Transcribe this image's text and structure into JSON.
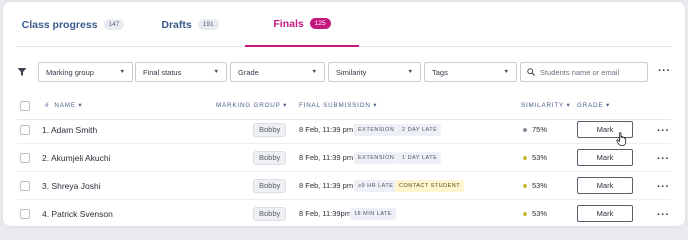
{
  "tabs": [
    {
      "label": "Class progress",
      "count": "147"
    },
    {
      "label": "Drafts",
      "count": "191"
    },
    {
      "label": "Finals",
      "count": "125"
    }
  ],
  "filters": {
    "marking_group": "Marking group",
    "final_status": "Final status",
    "grade": "Grade",
    "similarity": "Similarity",
    "tags": "Tags",
    "search_placeholder": "Students name or email"
  },
  "columns": {
    "number": "#",
    "name": "NAME",
    "marking_group": "MARKING GROUP",
    "final_submission": "FINAL SUBMISSION",
    "similarity": "SIMILARITY",
    "grade": "GRADE",
    "sort_glyph": "▾"
  },
  "rows": [
    {
      "name": "1. Adam Smith",
      "group": "Bobby",
      "date": "8 Feb, 11:39 pm",
      "badges": [
        "EXTENSION",
        "2 DAY LATE"
      ],
      "similarity": "75%",
      "sim_color": "#8e8896",
      "action": "Mark"
    },
    {
      "name": "2. Akumjeli Akuchi",
      "group": "Bobby",
      "date": "8 Feb, 11:39 pm",
      "badges": [
        "EXTENSION",
        "1 DAY LATE"
      ],
      "similarity": "53%",
      "sim_color": "#c9b93a",
      "action": "Mark"
    },
    {
      "name": "3. Shreya Joshi",
      "group": "Bobby",
      "date": "8 Feb, 11:39 pm",
      "badges": [
        "≥9 HR LATE",
        "CONTACT STUDENT"
      ],
      "similarity": "53%",
      "sim_color": "#c9b93a",
      "action": "Mark"
    },
    {
      "name": "4. Patrick Svenson",
      "group": "Bobby",
      "date": "8 Feb, 11:39pm",
      "badges": [
        "18 MIN LATE"
      ],
      "similarity": "53%",
      "sim_color": "#c9b93a",
      "action": "Mark"
    }
  ],
  "colors": {
    "accent": "#c2187f",
    "link": "#3a5a8c"
  }
}
